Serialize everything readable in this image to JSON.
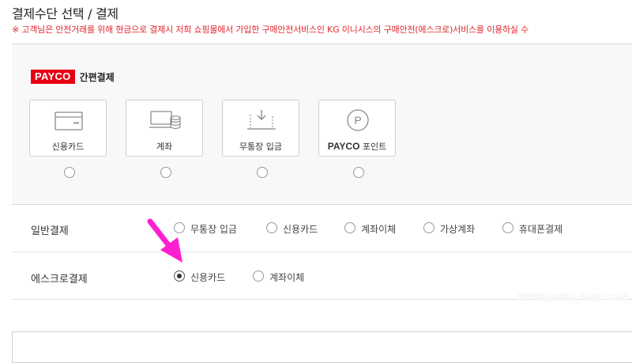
{
  "page": {
    "title": "결제수단 선택 / 결제",
    "notice": "※ 고객님은 안전거래를 위해 현금으로 결제시 저희 쇼핑몰에서 가입한 구매안전서비스인 KG 이니시스의 구매안전(에스크로)서비스를 이용하실 수"
  },
  "payco": {
    "logo": "PAYCO",
    "header": "간편결제",
    "options": [
      {
        "label": "신용카드",
        "icon": "credit-card-icon",
        "selected": false
      },
      {
        "label": "계좌",
        "icon": "bank-account-icon",
        "selected": false
      },
      {
        "label": "무통장 입금",
        "icon": "bank-deposit-icon",
        "selected": false
      },
      {
        "brand": "PAYCO",
        "label": " 포인트",
        "icon": "payco-point-icon",
        "selected": false
      }
    ]
  },
  "general_payment": {
    "label": "일반결제",
    "options": [
      "무통장 입금",
      "신용카드",
      "계좌이체",
      "가상계좌",
      "휴대폰결제"
    ],
    "selected": null
  },
  "escrow_payment": {
    "label": "에스크로결제",
    "options": [
      "신용카드",
      "계좌이체"
    ],
    "selected": "신용카드"
  },
  "colors": {
    "notice": "#e0262e",
    "payco_brand": "#e60012",
    "annotation_arrow": "#ff1fd1"
  },
  "watermark": "SPEEDINKLAND.COM"
}
